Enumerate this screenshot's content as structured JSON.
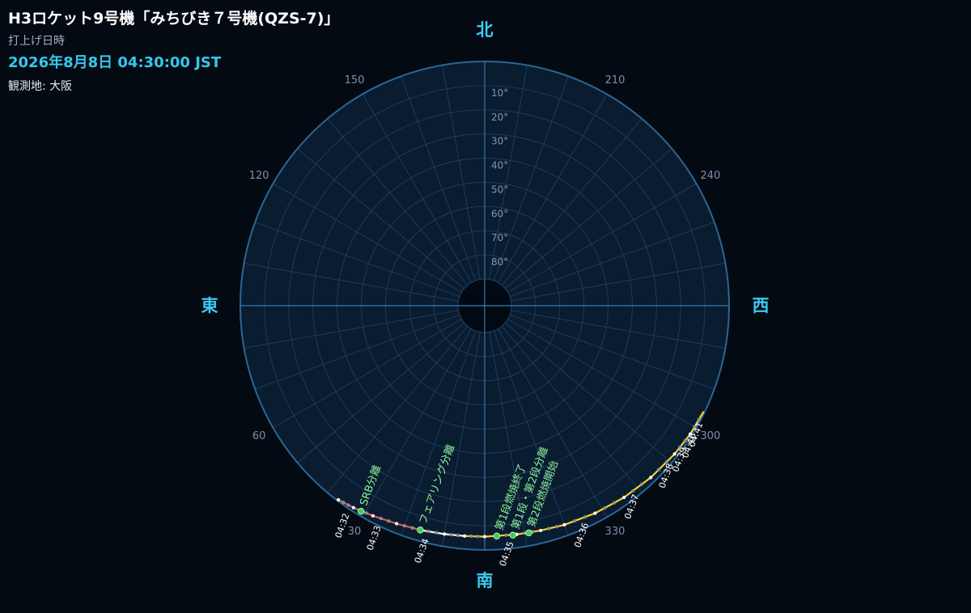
{
  "title": "H3ロケット9号機「みちびき７号機(QZS-7)」",
  "launch_label": "打上げ日時",
  "launch_time": "2026年8月8日 04:30:00 JST",
  "location": "観測地: 大阪",
  "colors": {
    "background": "#040a12",
    "plot_bg": "#0a1c30",
    "grid": "#1d4468",
    "accent": "#3fc8f2",
    "event": "#8ff09a",
    "event_dot": "#39d353",
    "track_phase1": "#e05a5a",
    "track_phase2": "#ffffff",
    "track_phase3": "#ffd21f"
  },
  "chart_data": {
    "type": "polar-sky",
    "directions": {
      "north": "北",
      "south": "南",
      "east": "東",
      "west": "西"
    },
    "azimuth_ticks": [
      {
        "az": 30,
        "label": "30"
      },
      {
        "az": 60,
        "label": "60"
      },
      {
        "az": 120,
        "label": "120"
      },
      {
        "az": 150,
        "label": "150"
      },
      {
        "az": 210,
        "label": "210"
      },
      {
        "az": 240,
        "label": "240"
      },
      {
        "az": 300,
        "label": "300"
      },
      {
        "az": 330,
        "label": "330"
      }
    ],
    "altitude_ticks": [
      {
        "alt": 10,
        "label": "10°"
      },
      {
        "alt": 20,
        "label": "20°"
      },
      {
        "alt": 30,
        "label": "30°"
      },
      {
        "alt": 40,
        "label": "40°"
      },
      {
        "alt": 50,
        "label": "50°"
      },
      {
        "alt": 60,
        "label": "60°"
      },
      {
        "alt": 70,
        "label": "70°"
      },
      {
        "alt": 80,
        "label": "80°"
      }
    ],
    "altitude_range": [
      0,
      90
    ],
    "track": [
      {
        "az": 37,
        "alt": 0.5
      },
      {
        "az": 33,
        "alt": 1.4
      },
      {
        "az": 28,
        "alt": 2.6
      },
      {
        "az": 22,
        "alt": 3.8
      },
      {
        "az": 16,
        "alt": 4.5
      },
      {
        "az": 10,
        "alt": 5.1
      },
      {
        "az": 5,
        "alt": 5.4
      },
      {
        "az": 0,
        "alt": 5.5
      },
      {
        "az": -8,
        "alt": 5.5
      },
      {
        "az": -14,
        "alt": 5.2
      },
      {
        "az": -20,
        "alt": 4.6
      },
      {
        "az": -28,
        "alt": 3.8
      },
      {
        "az": -36,
        "alt": 3.0
      },
      {
        "az": -44,
        "alt": 2.2
      },
      {
        "az": -52,
        "alt": 1.4
      },
      {
        "az": -58,
        "alt": 0.8
      },
      {
        "az": -64,
        "alt": 0.5
      }
    ],
    "track_segments": [
      {
        "from": 0,
        "to": 4,
        "phase": "phase1"
      },
      {
        "from": 4,
        "to": 6,
        "phase": "phase2"
      },
      {
        "from": 6,
        "to": 16,
        "phase": "phase3"
      }
    ],
    "time_labels": [
      {
        "label": "04:32",
        "az": 34,
        "alt": 0.4
      },
      {
        "label": "04:33",
        "az": 26,
        "alt": 2.5
      },
      {
        "label": "04:34",
        "az": 14,
        "alt": 4.3
      },
      {
        "label": "04:35",
        "az": -7,
        "alt": 5.2
      },
      {
        "label": "04:36",
        "az": -26,
        "alt": 3.8
      },
      {
        "label": "04:37",
        "az": -40,
        "alt": 2.4
      },
      {
        "label": "04:38",
        "az": -51,
        "alt": 1.2
      },
      {
        "label": "04:39",
        "az": -56,
        "alt": 0.7
      },
      {
        "label": "04:40",
        "az": -60,
        "alt": 0.4
      },
      {
        "label": "04:41",
        "az": -63,
        "alt": 0.2
      }
    ],
    "events": [
      {
        "label": "SRB分離",
        "az": 31,
        "alt": 1.8
      },
      {
        "label": "フェアリング分離",
        "az": 16,
        "alt": 4.5
      },
      {
        "label": "第1段・第2段分離",
        "az": -7,
        "alt": 5.4
      },
      {
        "label": "第1段燃焼終了",
        "az": -3,
        "alt": 5.6
      },
      {
        "label": "第2段燃焼開始",
        "az": -11,
        "alt": 5.3
      }
    ]
  }
}
